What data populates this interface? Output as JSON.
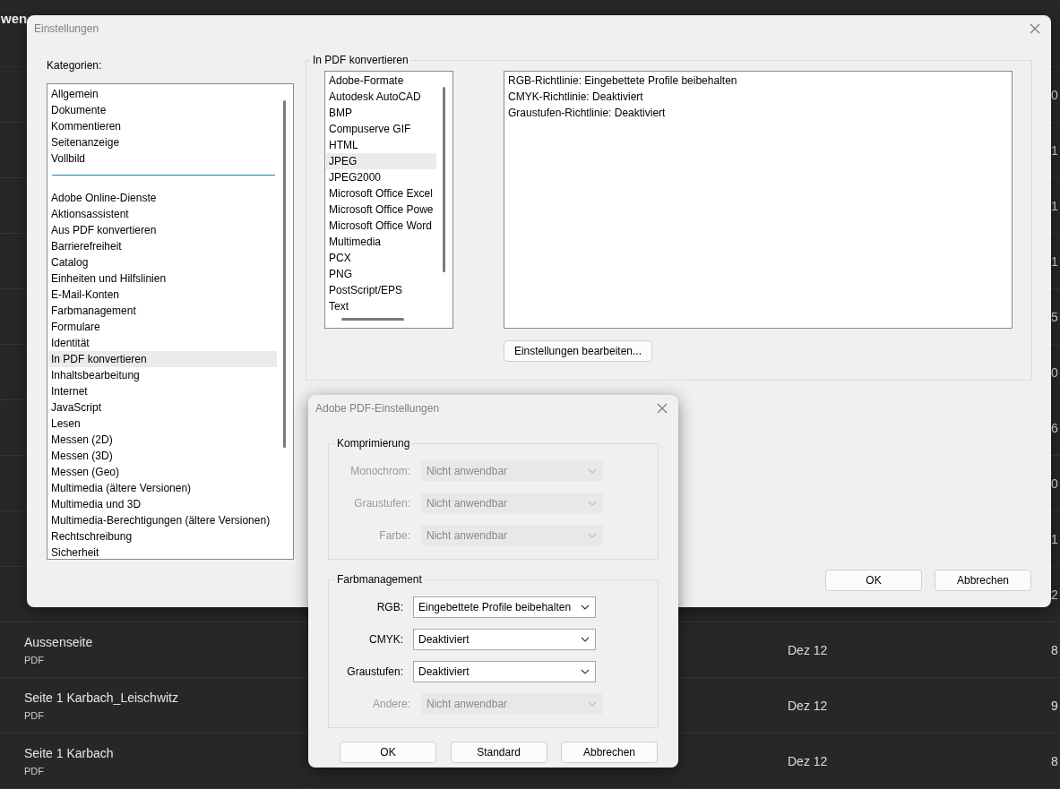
{
  "background": {
    "title": "wen",
    "rows": [
      {
        "size": "0"
      },
      {
        "size": "1"
      },
      {
        "size": "1"
      },
      {
        "size": "1"
      },
      {
        "size": "5"
      },
      {
        "size": "0"
      },
      {
        "size": "6"
      },
      {
        "size": "0"
      },
      {
        "size": "1"
      },
      {
        "size": "2"
      },
      {
        "name": "Aussenseite",
        "type": "PDF",
        "date": "Dez 12",
        "size": "8"
      },
      {
        "name": "Seite 1 Karbach_Leischwitz",
        "type": "PDF",
        "date": "Dez 12",
        "size": "9"
      },
      {
        "name": "Seite 1 Karbach",
        "type": "PDF",
        "date": "Dez 12",
        "size": "8"
      }
    ]
  },
  "settings_dialog": {
    "title": "Einstellungen",
    "categories_label": "Kategorien:",
    "category_groups": [
      {
        "items": [
          {
            "label": "Allgemein",
            "selected": false
          },
          {
            "label": "Dokumente",
            "selected": false
          },
          {
            "label": "Kommentieren",
            "selected": false
          },
          {
            "label": "Seitenanzeige",
            "selected": false
          },
          {
            "label": "Vollbild",
            "selected": false
          }
        ]
      },
      {
        "items": [
          {
            "label": "Adobe Online-Dienste",
            "selected": false
          },
          {
            "label": "Aktionsassistent",
            "selected": false
          },
          {
            "label": "Aus PDF konvertieren",
            "selected": false
          },
          {
            "label": "Barrierefreiheit",
            "selected": false
          },
          {
            "label": "Catalog",
            "selected": false
          },
          {
            "label": "Einheiten und Hilfslinien",
            "selected": false
          },
          {
            "label": "E-Mail-Konten",
            "selected": false
          },
          {
            "label": "Farbmanagement",
            "selected": false
          },
          {
            "label": "Formulare",
            "selected": false
          },
          {
            "label": "Identität",
            "selected": false
          },
          {
            "label": "In PDF konvertieren",
            "selected": true
          },
          {
            "label": "Inhaltsbearbeitung",
            "selected": false
          },
          {
            "label": "Internet",
            "selected": false
          },
          {
            "label": "JavaScript",
            "selected": false
          },
          {
            "label": "Lesen",
            "selected": false
          },
          {
            "label": "Messen (2D)",
            "selected": false
          },
          {
            "label": "Messen (3D)",
            "selected": false
          },
          {
            "label": "Messen (Geo)",
            "selected": false
          },
          {
            "label": "Multimedia (ältere Versionen)",
            "selected": false
          },
          {
            "label": "Multimedia und 3D",
            "selected": false
          },
          {
            "label": "Multimedia-Berechtigungen (ältere Versionen)",
            "selected": false
          },
          {
            "label": "Rechtschreibung",
            "selected": false
          },
          {
            "label": "Sicherheit",
            "selected": false
          }
        ]
      }
    ],
    "section": {
      "title": "In PDF konvertieren",
      "formats": [
        {
          "label": "Adobe-Formate",
          "selected": false
        },
        {
          "label": "Autodesk AutoCAD",
          "selected": false
        },
        {
          "label": "BMP",
          "selected": false
        },
        {
          "label": "Compuserve GIF",
          "selected": false
        },
        {
          "label": "HTML",
          "selected": false
        },
        {
          "label": "JPEG",
          "selected": true
        },
        {
          "label": "JPEG2000",
          "selected": false
        },
        {
          "label": "Microsoft Office Excel",
          "selected": false
        },
        {
          "label": "Microsoft Office Powe",
          "selected": false
        },
        {
          "label": "Microsoft Office Word",
          "selected": false
        },
        {
          "label": "Multimedia",
          "selected": false
        },
        {
          "label": "PCX",
          "selected": false
        },
        {
          "label": "PNG",
          "selected": false
        },
        {
          "label": "PostScript/EPS",
          "selected": false
        },
        {
          "label": "Text",
          "selected": false
        }
      ],
      "policies": [
        "RGB-Richtlinie: Eingebettete Profile beibehalten",
        "CMYK-Richtlinie: Deaktiviert",
        "Graustufen-Richtlinie: Deaktiviert"
      ],
      "edit_button": "Einstellungen bearbeiten..."
    },
    "buttons": [
      "OK",
      "Abbrechen"
    ]
  },
  "pdf_dialog": {
    "title": "Adobe PDF-Einstellungen",
    "groups": [
      {
        "title": "Komprimierung",
        "rows": [
          {
            "label": "Monochrom:",
            "value": "Nicht anwendbar",
            "disabled": true
          },
          {
            "label": "Graustufen:",
            "value": "Nicht anwendbar",
            "disabled": true
          },
          {
            "label": "Farbe:",
            "value": "Nicht anwendbar",
            "disabled": true
          }
        ]
      },
      {
        "title": "Farbmanagement",
        "rows": [
          {
            "label": "RGB:",
            "value": "Eingebettete Profile beibehalten",
            "disabled": false
          },
          {
            "label": "CMYK:",
            "value": "Deaktiviert",
            "disabled": false
          },
          {
            "label": "Graustufen:",
            "value": "Deaktiviert",
            "disabled": false
          },
          {
            "label": "Andere:",
            "value": "Nicht anwendbar",
            "disabled": true
          }
        ]
      }
    ],
    "buttons": [
      "OK",
      "Standard",
      "Abbrechen"
    ]
  }
}
